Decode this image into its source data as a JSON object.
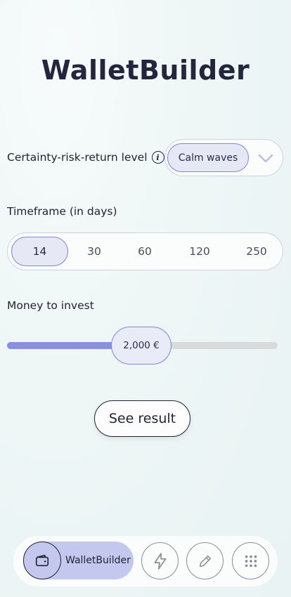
{
  "app": {
    "title": "WalletBuilder"
  },
  "risk": {
    "label": "Certainty-risk-return level",
    "info_icon": "info-icon",
    "selected": "Calm waves",
    "dropdown_icon": "chevron-down-icon"
  },
  "timeframe": {
    "label": "Timeframe (in days)",
    "options": [
      "14",
      "30",
      "60",
      "120",
      "250"
    ],
    "selected": "14"
  },
  "money": {
    "label": "Money to invest",
    "value_label": "2,000 €",
    "fill_fraction": 0.42
  },
  "actions": {
    "see_result": "See result"
  },
  "nav": {
    "active_label": "WalletBuilder",
    "items": [
      {
        "icon": "wallet-icon"
      },
      {
        "icon": "lightning-icon"
      },
      {
        "icon": "pencil-icon"
      },
      {
        "icon": "grid-icon"
      }
    ]
  },
  "colors": {
    "accent": "#8990dc",
    "accent_light": "#e6e8f6",
    "nav_active_bg": "#c4c8ee",
    "text": "#1f2233"
  }
}
